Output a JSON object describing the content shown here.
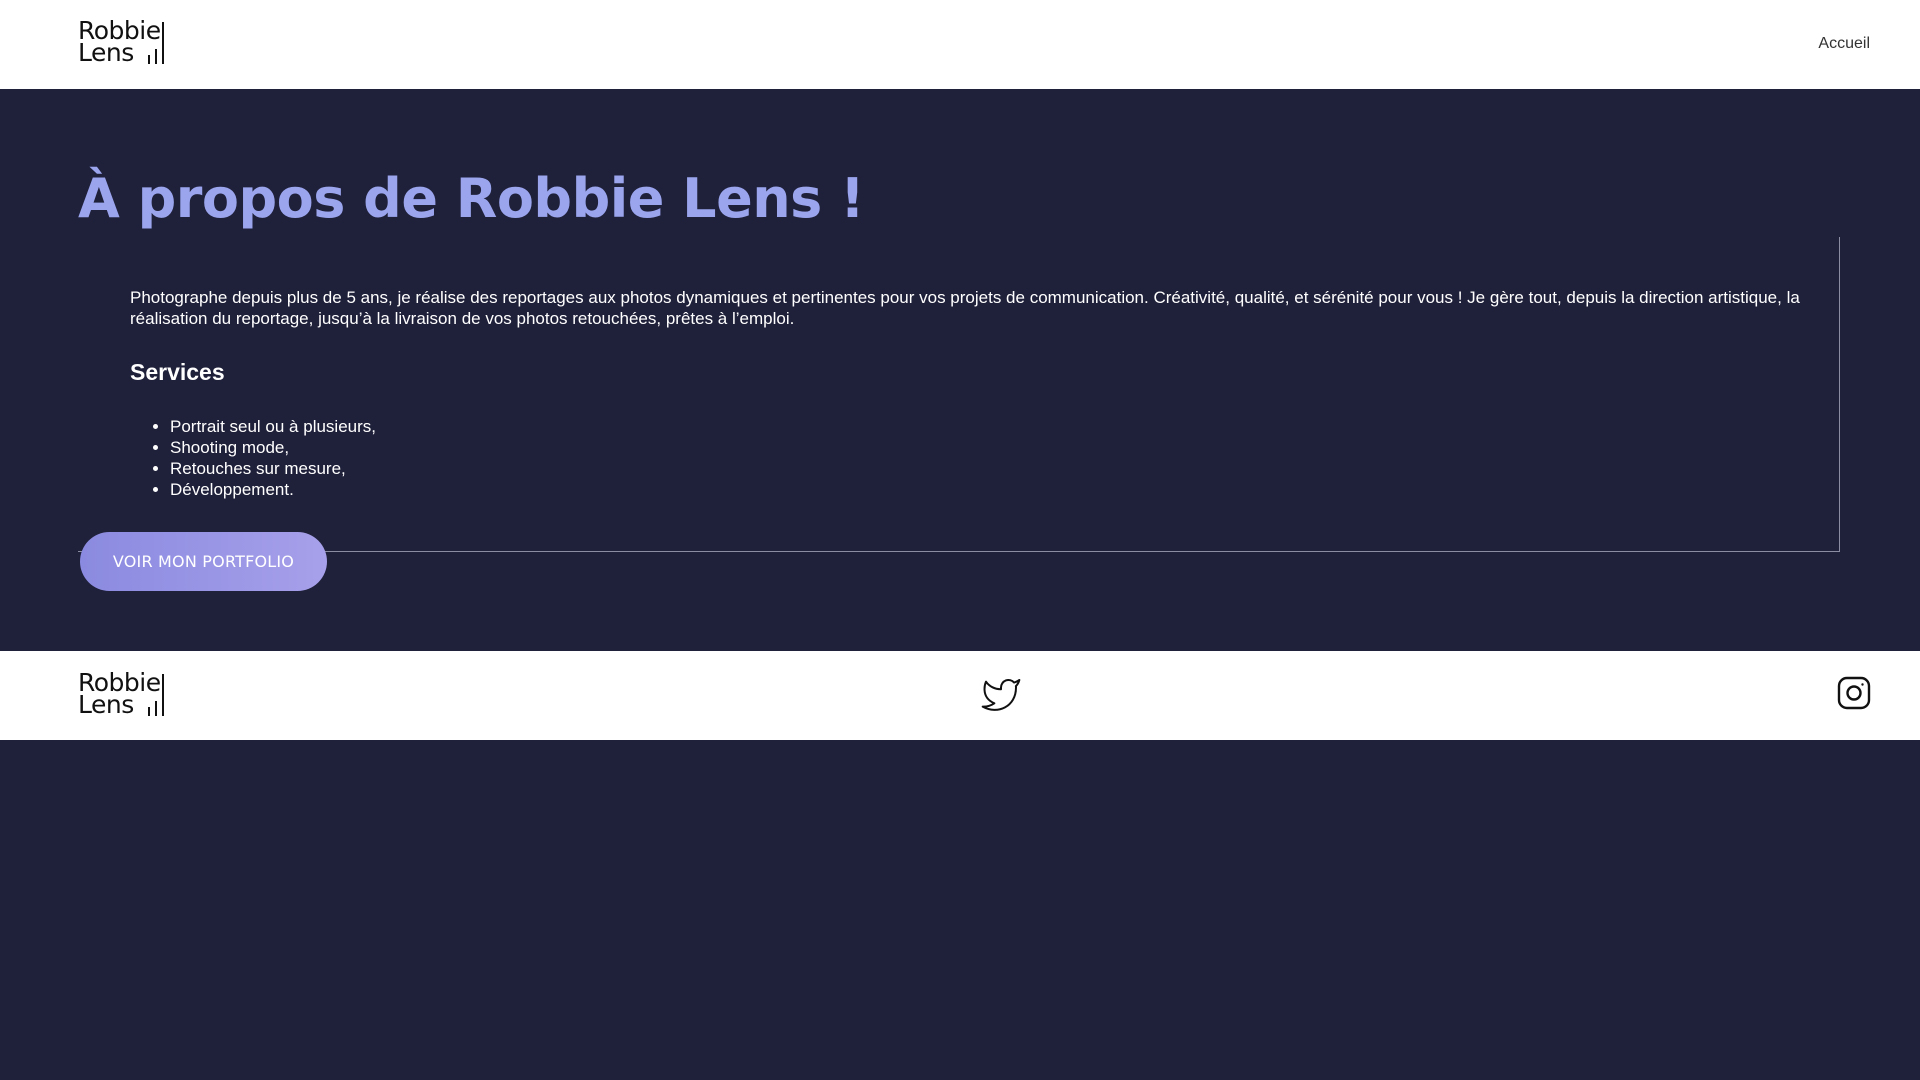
{
  "header": {
    "logo": {
      "line1": "Robbie",
      "line2": "Lens"
    },
    "nav": {
      "home_label": "Accueil"
    }
  },
  "main": {
    "title": "À propos de Robbie Lens !",
    "about_text": "Photographe depuis plus de 5 ans, je réalise des reportages aux photos dynamiques et pertinentes pour vos projets de communication. Créativité, qualité, et sérénité pour vous ! Je gère tout, depuis la direction artistique, la réalisation du reportage, jusqu’à la livraison de vos photos retouchées, prêtes à l’emploi.",
    "services_title": "Services",
    "services": [
      "Portrait seul ou à plusieurs,",
      "Shooting mode,",
      "Retouches sur mesure,",
      "Développement."
    ],
    "portfolio_button": "VOIR MON PORTFOLIO"
  },
  "footer": {
    "logo": {
      "line1": "Robbie",
      "line2": "Lens"
    },
    "social": [
      {
        "icon": "twitter-icon"
      },
      {
        "icon": "instagram-icon"
      }
    ]
  },
  "colors": {
    "background": "#1f203a",
    "title_accent": "#9aa5ee",
    "button_start": "#8a8ae0",
    "button_end": "#a7a0ea"
  }
}
